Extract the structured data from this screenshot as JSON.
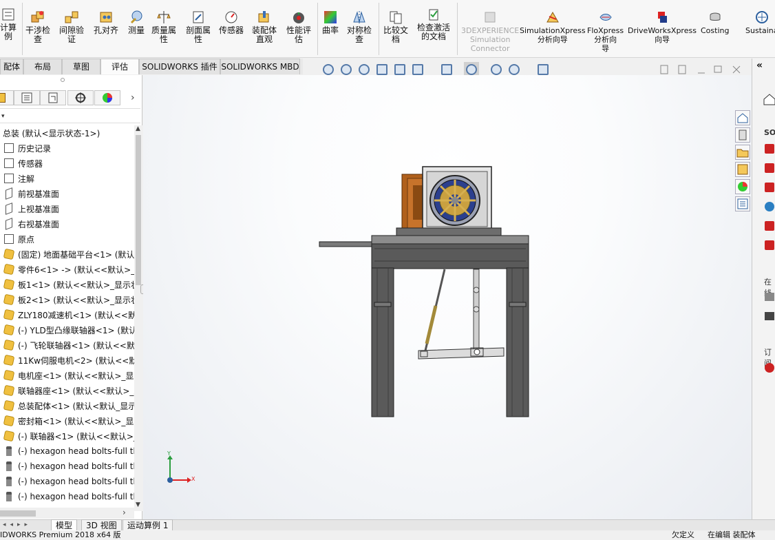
{
  "ribbon": {
    "items": [
      {
        "label": "计算\n例"
      },
      {
        "label": "干涉检\n查"
      },
      {
        "label": "间隙验\n证"
      },
      {
        "label": "孔对齐"
      },
      {
        "label": "测量"
      },
      {
        "label": "质量属\n性"
      },
      {
        "label": "剖面属\n性"
      },
      {
        "label": "传感器"
      },
      {
        "label": "装配体\n直观"
      },
      {
        "label": "性能评\n估"
      },
      {
        "label": "曲率"
      },
      {
        "label": "对称检\n查"
      },
      {
        "label": "比较文\n档"
      },
      {
        "label": "检查激活\n的文档"
      },
      {
        "label": "3DEXPERIENCE\nSimulation\nConnector"
      },
      {
        "label": "SimulationXpress\n分析向导"
      },
      {
        "label": "FloXpress\n分析向\n导"
      },
      {
        "label": "DriveWorksXpress\n向导"
      },
      {
        "label": "Costing"
      },
      {
        "label": "Sustaina"
      }
    ]
  },
  "tabs": [
    "配体",
    "布局",
    "草图",
    "评估",
    "SOLIDWORKS 插件",
    "SOLIDWORKS MBD"
  ],
  "tree": {
    "root": "总装 (默认<显示状态-1>)",
    "items": [
      {
        "label": "历史记录",
        "icon": "history-icon"
      },
      {
        "label": "传感器",
        "icon": "sensor-icon"
      },
      {
        "label": "注解",
        "icon": "annotation-icon"
      },
      {
        "label": "前视基准面",
        "icon": "plane-icon"
      },
      {
        "label": "上视基准面",
        "icon": "plane-icon"
      },
      {
        "label": "右视基准面",
        "icon": "plane-icon"
      },
      {
        "label": "原点",
        "icon": "origin-icon"
      },
      {
        "label": "(固定) 地面基础平台<1> (默认",
        "icon": "part-icon"
      },
      {
        "label": "零件6<1> -> (默认<<默认>_显",
        "icon": "part-icon"
      },
      {
        "label": "板1<1> (默认<<默认>_显示状",
        "icon": "part-icon"
      },
      {
        "label": "板2<1> (默认<<默认>_显示状",
        "icon": "part-icon"
      },
      {
        "label": "ZLY180减速机<1> (默认<<默",
        "icon": "part-icon"
      },
      {
        "label": "(-) YLD型凸缘联轴器<1> (默认",
        "icon": "part-icon"
      },
      {
        "label": "(-) 飞轮联轴器<1> (默认<<默",
        "icon": "part-icon"
      },
      {
        "label": "11Kw伺服电机<2> (默认<<默",
        "icon": "part-icon"
      },
      {
        "label": "电机座<1> (默认<<默认>_显示",
        "icon": "part-icon"
      },
      {
        "label": "联轴器座<1> (默认<<默认>_显",
        "icon": "part-icon"
      },
      {
        "label": "总装配体<1> (默认<默认_显示",
        "icon": "subassembly-icon"
      },
      {
        "label": "密封箱<1> (默认<<默认>_显示",
        "icon": "part-icon"
      },
      {
        "label": "(-) 联轴器<1> (默认<<默认>_",
        "icon": "part-icon"
      },
      {
        "label": "(-) hexagon head bolts-full th",
        "icon": "bolt-icon"
      },
      {
        "label": "(-) hexagon head bolts-full th",
        "icon": "bolt-icon"
      },
      {
        "label": "(-) hexagon head bolts-full th",
        "icon": "bolt-icon"
      },
      {
        "label": "(-) hexagon head bolts-full th",
        "icon": "bolt-icon"
      }
    ]
  },
  "triad": {
    "y": "Y",
    "x": "X"
  },
  "bottom_tabs": [
    "模型",
    "3D 视图",
    "运动算例 1"
  ],
  "status": {
    "left": "IDWORKS Premium 2018 x64 版",
    "mid": "欠定义",
    "right": "在编辑 装配体"
  },
  "right_panel": {
    "sol": "SOL",
    "zai": "在线",
    "ding": "订阅"
  }
}
